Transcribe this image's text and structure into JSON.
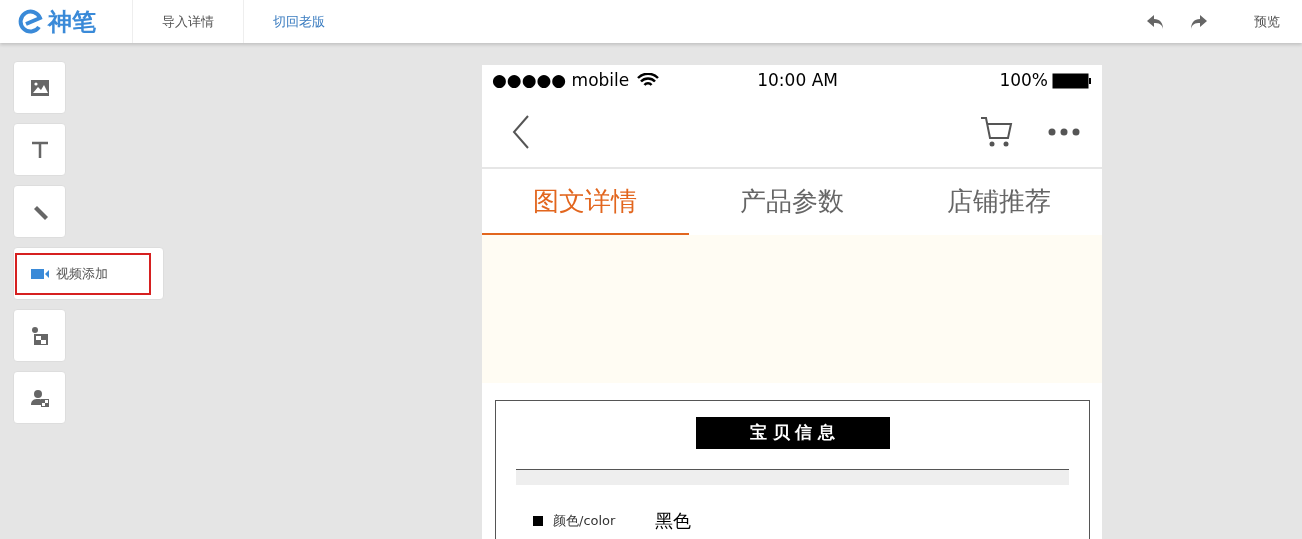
{
  "topbar": {
    "logo": "神笔",
    "menu": [
      {
        "label": "导入详情",
        "kind": "plain"
      },
      {
        "label": "切回老版",
        "kind": "link"
      }
    ],
    "preview": "预览"
  },
  "tools": [
    {
      "kind": "image",
      "highlighted": false
    },
    {
      "kind": "text",
      "highlighted": false
    },
    {
      "kind": "ruler",
      "highlighted": false
    },
    {
      "kind": "video",
      "label": "视频添加",
      "highlighted": true
    },
    {
      "kind": "blocks",
      "highlighted": false
    },
    {
      "kind": "person",
      "highlighted": false
    }
  ],
  "phone": {
    "status": {
      "carrier": "●●●●● mobile",
      "time": "10:00 AM",
      "battery": "100%"
    },
    "tabs": [
      {
        "label": "图文详情",
        "selected": true
      },
      {
        "label": "产品参数",
        "selected": false
      },
      {
        "label": "店铺推荐",
        "selected": false
      }
    ],
    "detail": {
      "banner": "宝 贝 信 息",
      "specs": [
        {
          "label": "颜色/color",
          "value": "黑色"
        }
      ]
    }
  }
}
